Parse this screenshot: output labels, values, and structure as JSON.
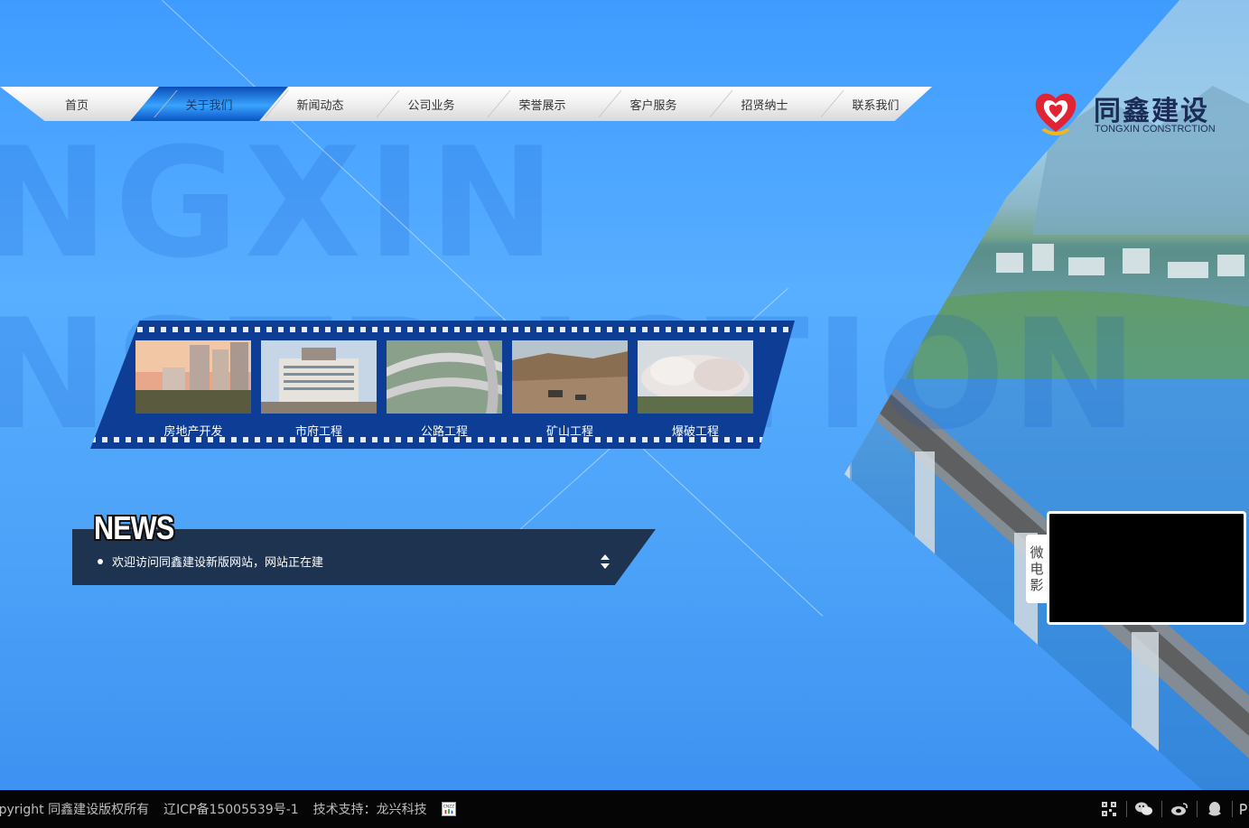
{
  "background": {
    "watermark_lines": [
      "NGXIN",
      "NSTRUCTION"
    ]
  },
  "nav": {
    "items": [
      {
        "label": "首页",
        "active": false
      },
      {
        "label": "关于我们",
        "active": true
      },
      {
        "label": "新闻动态",
        "active": false
      },
      {
        "label": "公司业务",
        "active": false
      },
      {
        "label": "荣誉展示",
        "active": false
      },
      {
        "label": "客户服务",
        "active": false
      },
      {
        "label": "招贤纳士",
        "active": false
      },
      {
        "label": "联系我们",
        "active": false
      }
    ]
  },
  "logo": {
    "name_cn": "同鑫建设",
    "name_en": "TONGXIN CONSTRCTION",
    "icon": "heart-logo-icon"
  },
  "business": {
    "items": [
      {
        "label": "房地产开发",
        "image": "real-estate-photo"
      },
      {
        "label": "市府工程",
        "image": "government-building-photo"
      },
      {
        "label": "公路工程",
        "image": "highway-interchange-photo"
      },
      {
        "label": "矿山工程",
        "image": "mine-site-photo"
      },
      {
        "label": "爆破工程",
        "image": "demolition-blast-photo"
      }
    ]
  },
  "news": {
    "title": "NEWS",
    "items": [
      "欢迎访问同鑫建设新版网站，网站正在建"
    ]
  },
  "video": {
    "tab_chars": [
      "微",
      "电",
      "影"
    ]
  },
  "footer": {
    "copyright": "opyright  同鑫建设版权所有",
    "icp": "辽ICP备15005539号-1",
    "support": "技术支持：龙兴科技",
    "cnzz_label": "CNZZ",
    "icons": [
      "qrcode-icon",
      "wechat-icon",
      "weibo-icon",
      "qq-icon",
      "more-icon"
    ]
  },
  "colors": {
    "sky_blue": "#4aa1f7",
    "nav_active": "#1e6fe0",
    "film_blue": "#0e3d95",
    "news_bar": "#1d3350",
    "footer_bg": "#050505",
    "logo_red": "#e02433",
    "logo_navy": "#1b2d57"
  }
}
